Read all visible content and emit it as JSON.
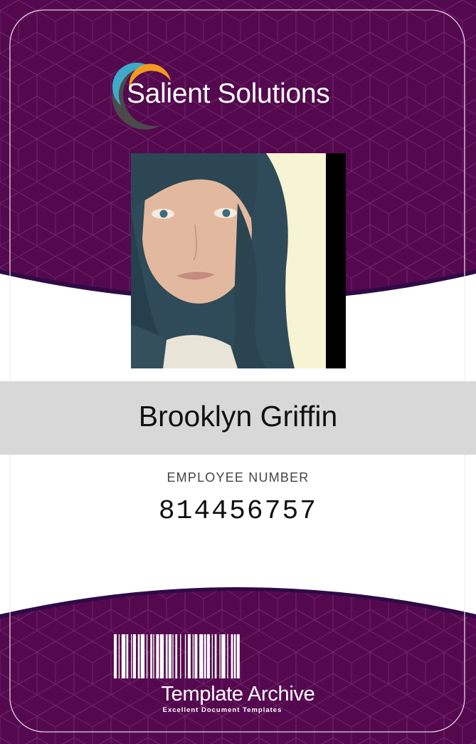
{
  "company": {
    "name": "Salient Solutions",
    "logo_icon": "swirl-logo-icon"
  },
  "employee": {
    "name": "Brooklyn Griffin",
    "number_label": "EMPLOYEE NUMBER",
    "number": "814456757",
    "photo_icon": "employee-portrait"
  },
  "footer": {
    "title": "Template Archive",
    "subtitle": "Excellent Document Templates",
    "barcode_icon": "barcode-icon"
  },
  "colors": {
    "brand_purple": "#54094f",
    "dark_purple": "#2f0a47",
    "name_bar_gray": "#d8d8d8",
    "logo_orange": "#f29a1f",
    "logo_teal": "#3fa9c9",
    "logo_gray": "#4a4a4a"
  }
}
